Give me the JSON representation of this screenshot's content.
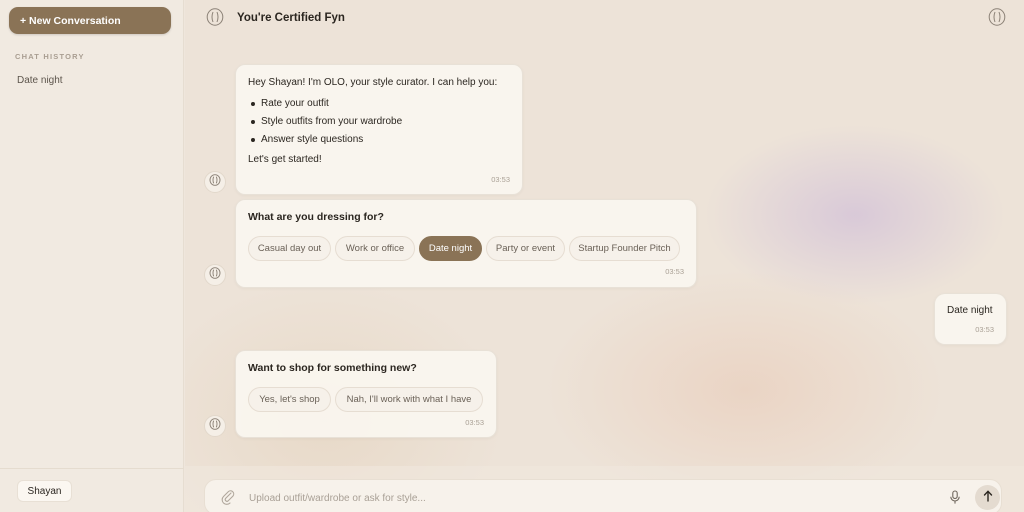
{
  "sidebar": {
    "new_conversation_label": "+ New Conversation",
    "history_heading": "CHAT HISTORY",
    "history_items": [
      {
        "label": "Date night"
      }
    ],
    "user_name": "Shayan"
  },
  "header": {
    "title": "You're Certified Fyn"
  },
  "messages": {
    "welcome": {
      "greeting": "Hey Shayan! I'm OLO, your style curator. I can help you:",
      "bullets": [
        "Rate your outfit",
        "Style outfits from your wardrobe",
        "Answer style questions"
      ],
      "closing": "Let's get started!",
      "time": "03:53"
    },
    "occasion": {
      "question": "What are you dressing for?",
      "options": [
        "Casual day out",
        "Work or office",
        "Date night",
        "Party or event",
        "Startup Founder Pitch"
      ],
      "selected": "Date night",
      "time": "03:53"
    },
    "user_reply": {
      "text": "Date night",
      "time": "03:53"
    },
    "shop": {
      "question": "Want to shop for something new?",
      "options": [
        "Yes, let's shop",
        "Nah, I'll work with what I have"
      ],
      "time": "03:53"
    }
  },
  "composer": {
    "placeholder": "Upload outfit/wardrobe or ask for style...",
    "value": ""
  },
  "icons": {
    "logo": "olo-logo-icon",
    "attach": "paperclip-icon",
    "mic": "microphone-icon",
    "send": "arrow-up-icon"
  },
  "colors": {
    "accent": "#8a7356",
    "background": "#ede3d8",
    "bubble": "#faf6f0"
  }
}
